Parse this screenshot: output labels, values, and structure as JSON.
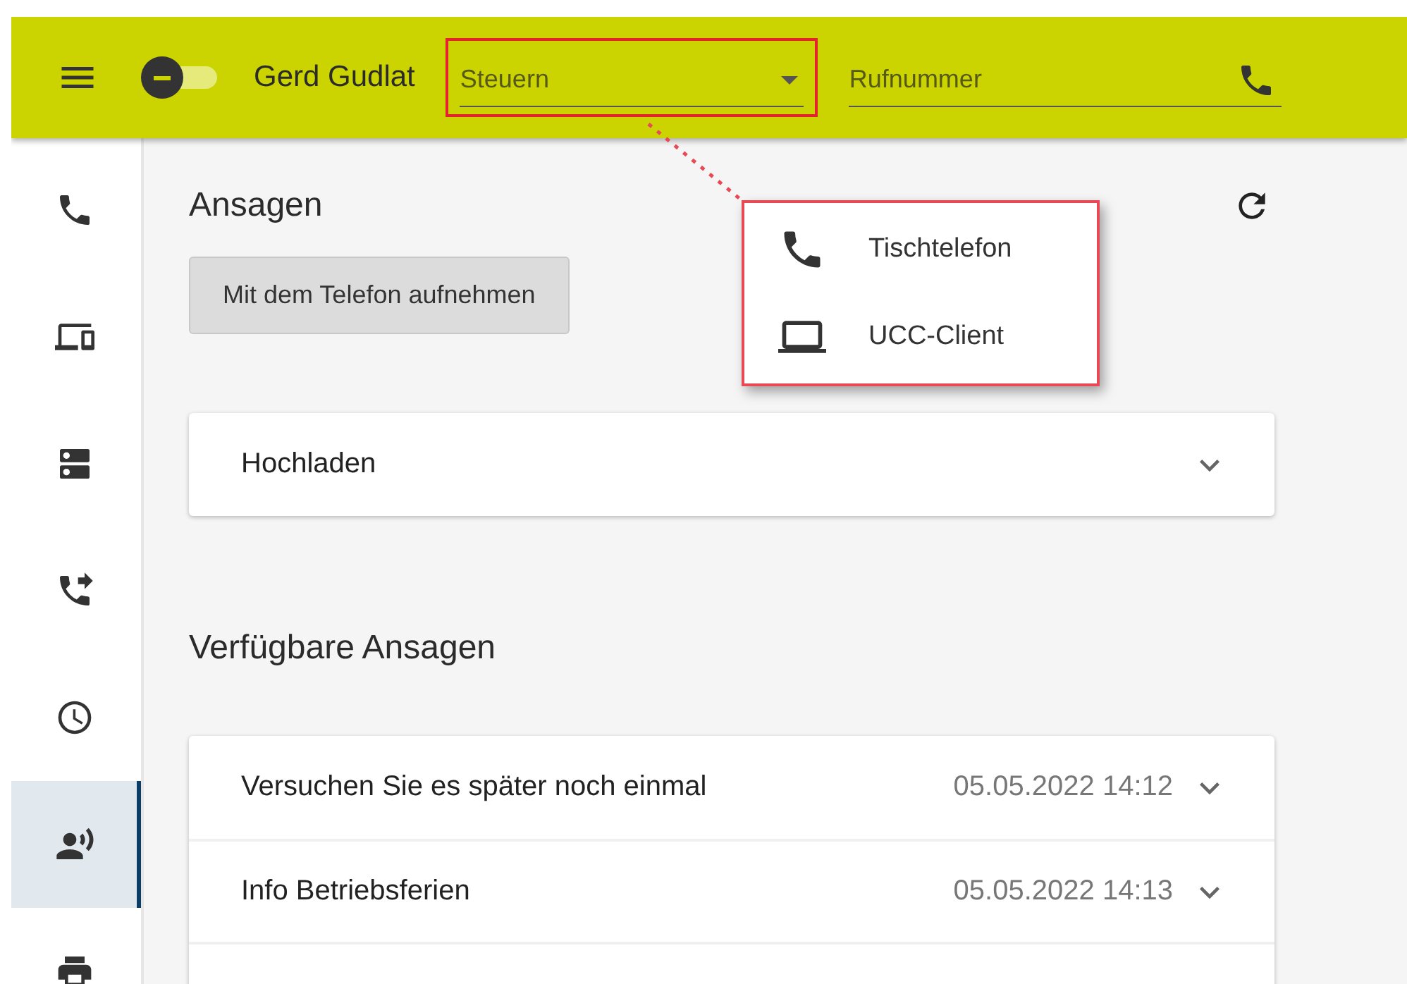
{
  "top_bar": {
    "user_name": "Gerd Gudlat",
    "presence_toggle": {
      "on": false
    },
    "control_select": {
      "placeholder": "Steuern",
      "highlighted": true
    },
    "phone_field": {
      "placeholder": "Rufnummer"
    }
  },
  "sidebar": {
    "items": [
      {
        "kind": "phone",
        "selected": false
      },
      {
        "kind": "devices",
        "selected": false
      },
      {
        "kind": "server",
        "selected": false
      },
      {
        "kind": "forward",
        "selected": false
      },
      {
        "kind": "clock",
        "selected": false
      },
      {
        "kind": "voice",
        "selected": true
      },
      {
        "kind": "printer",
        "selected": false
      }
    ]
  },
  "control_menu": {
    "items": [
      {
        "kind": "phone",
        "label": "Tischtelefon"
      },
      {
        "kind": "laptop",
        "label": "UCC-Client"
      }
    ]
  },
  "main": {
    "title": "Ansagen",
    "record_button": "Mit dem Telefon aufnehmen",
    "upload_panel": {
      "title": "Hochladen",
      "expanded": false
    },
    "list_title": "Verfügbare Ansagen",
    "announcements": [
      {
        "name": "Versuchen Sie es später noch einmal",
        "date": "05.05.2022 14:12",
        "expanded": false
      },
      {
        "name": "Info Betriebsferien",
        "date": "05.05.2022 14:13",
        "expanded": false
      }
    ]
  }
}
